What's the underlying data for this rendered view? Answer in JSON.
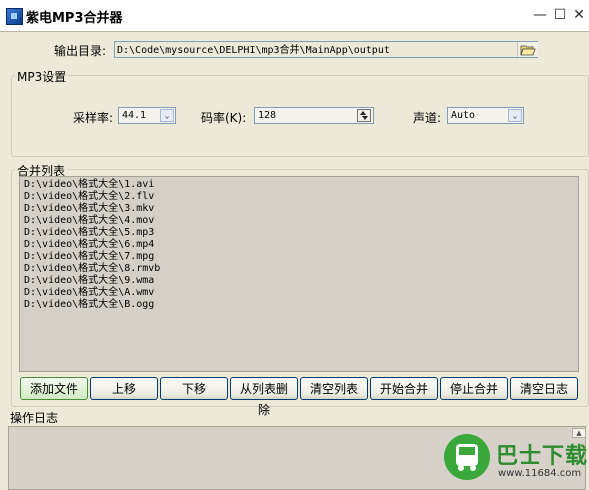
{
  "window": {
    "title": "紫电MP3合并器",
    "controls": {
      "minimize": "—",
      "maximize": "☐",
      "close": "✕"
    }
  },
  "output": {
    "label": "输出目录:",
    "path": "D:\\Code\\mysource\\DELPHI\\mp3合并\\MainApp\\output",
    "browse_icon": "folder-open-icon"
  },
  "mp3_settings": {
    "group_title": "MP3设置",
    "sample_rate_label": "采样率:",
    "sample_rate_value": "44.1",
    "bitrate_label": "码率(K):",
    "bitrate_value": "128",
    "channel_label": "声道:",
    "channel_value": "Auto"
  },
  "merge_list": {
    "group_title": "合并列表",
    "items": [
      "D:\\video\\格式大全\\1.avi",
      "D:\\video\\格式大全\\2.flv",
      "D:\\video\\格式大全\\3.mkv",
      "D:\\video\\格式大全\\4.mov",
      "D:\\video\\格式大全\\5.mp3",
      "D:\\video\\格式大全\\6.mp4",
      "D:\\video\\格式大全\\7.mpg",
      "D:\\video\\格式大全\\8.rmvb",
      "D:\\video\\格式大全\\9.wma",
      "D:\\video\\格式大全\\A.wmv",
      "D:\\video\\格式大全\\B.ogg"
    ]
  },
  "buttons": {
    "add_file": "添加文件",
    "move_up": "上移",
    "move_down": "下移",
    "remove": "从列表删除",
    "clear_list": "清空列表",
    "start_merge": "开始合并",
    "stop_merge": "停止合并",
    "clear_log": "清空日志"
  },
  "log": {
    "label": "操作日志"
  },
  "watermark": {
    "brand": "巴士下载",
    "url": "www.11684.com"
  },
  "colors": {
    "window_bg": "#ece9d8",
    "list_bg": "#d4d0c8",
    "button_border": "#003c74",
    "watermark_green": "#3aa83a"
  }
}
